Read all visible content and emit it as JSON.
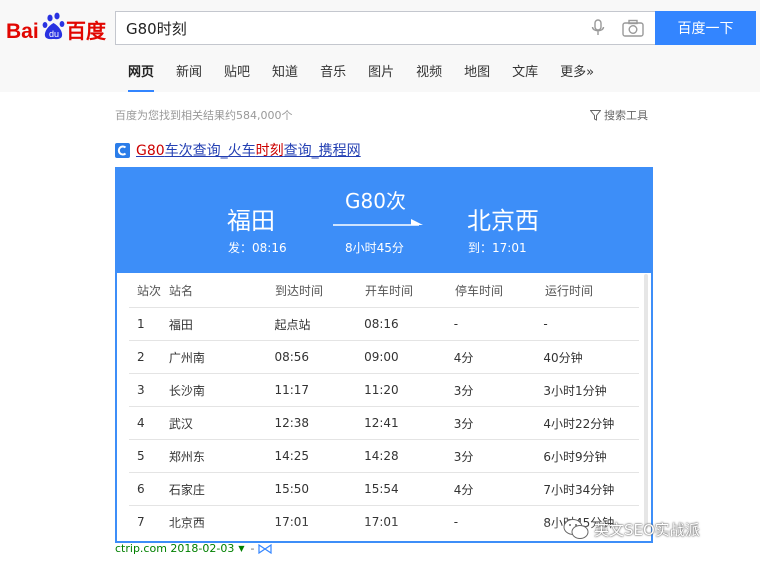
{
  "header": {
    "logo_text": "Baidu百度",
    "search_value": "G80时刻",
    "search_button": "百度一下"
  },
  "tabs": [
    {
      "label": "网页",
      "active": true
    },
    {
      "label": "新闻"
    },
    {
      "label": "贴吧"
    },
    {
      "label": "知道"
    },
    {
      "label": "音乐"
    },
    {
      "label": "图片"
    },
    {
      "label": "视频"
    },
    {
      "label": "地图"
    },
    {
      "label": "文库"
    },
    {
      "label": "更多»"
    }
  ],
  "result_count": "百度为您找到相关结果约584,000个",
  "search_tools": "搜索工具",
  "result": {
    "title_parts": [
      "G80",
      "车次查询_火车",
      "时刻",
      "查询_携程网"
    ],
    "url": "ctrip.com 2018-02-03",
    "dash": "-"
  },
  "train": {
    "from": "福田",
    "from_time": "发：08:16",
    "train_no": "G80次",
    "duration": "8小时45分",
    "to": "北京西",
    "to_time": "到：17:01"
  },
  "table": {
    "headers": [
      "站次",
      "站名",
      "到达时间",
      "开车时间",
      "停车时间",
      "运行时间"
    ],
    "rows": [
      [
        "1",
        "福田",
        "起点站",
        "08:16",
        "-",
        "-"
      ],
      [
        "2",
        "广州南",
        "08:56",
        "09:00",
        "4分",
        "40分钟"
      ],
      [
        "3",
        "长沙南",
        "11:17",
        "11:20",
        "3分",
        "3小时1分钟"
      ],
      [
        "4",
        "武汉",
        "12:38",
        "12:41",
        "3分",
        "4小时22分钟"
      ],
      [
        "5",
        "郑州东",
        "14:25",
        "14:28",
        "3分",
        "6小时9分钟"
      ],
      [
        "6",
        "石家庄",
        "15:50",
        "15:54",
        "4分",
        "7小时34分钟"
      ],
      [
        "7",
        "北京西",
        "17:01",
        "17:01",
        "-",
        "8小时45分钟"
      ]
    ]
  },
  "watermark": "英文SEO实战派",
  "colors": {
    "brand_blue": "#3385ff",
    "card_blue": "#3d8ef8",
    "link_blue": "#2440b3",
    "highlight_red": "#cc0000",
    "url_green": "#008000"
  }
}
